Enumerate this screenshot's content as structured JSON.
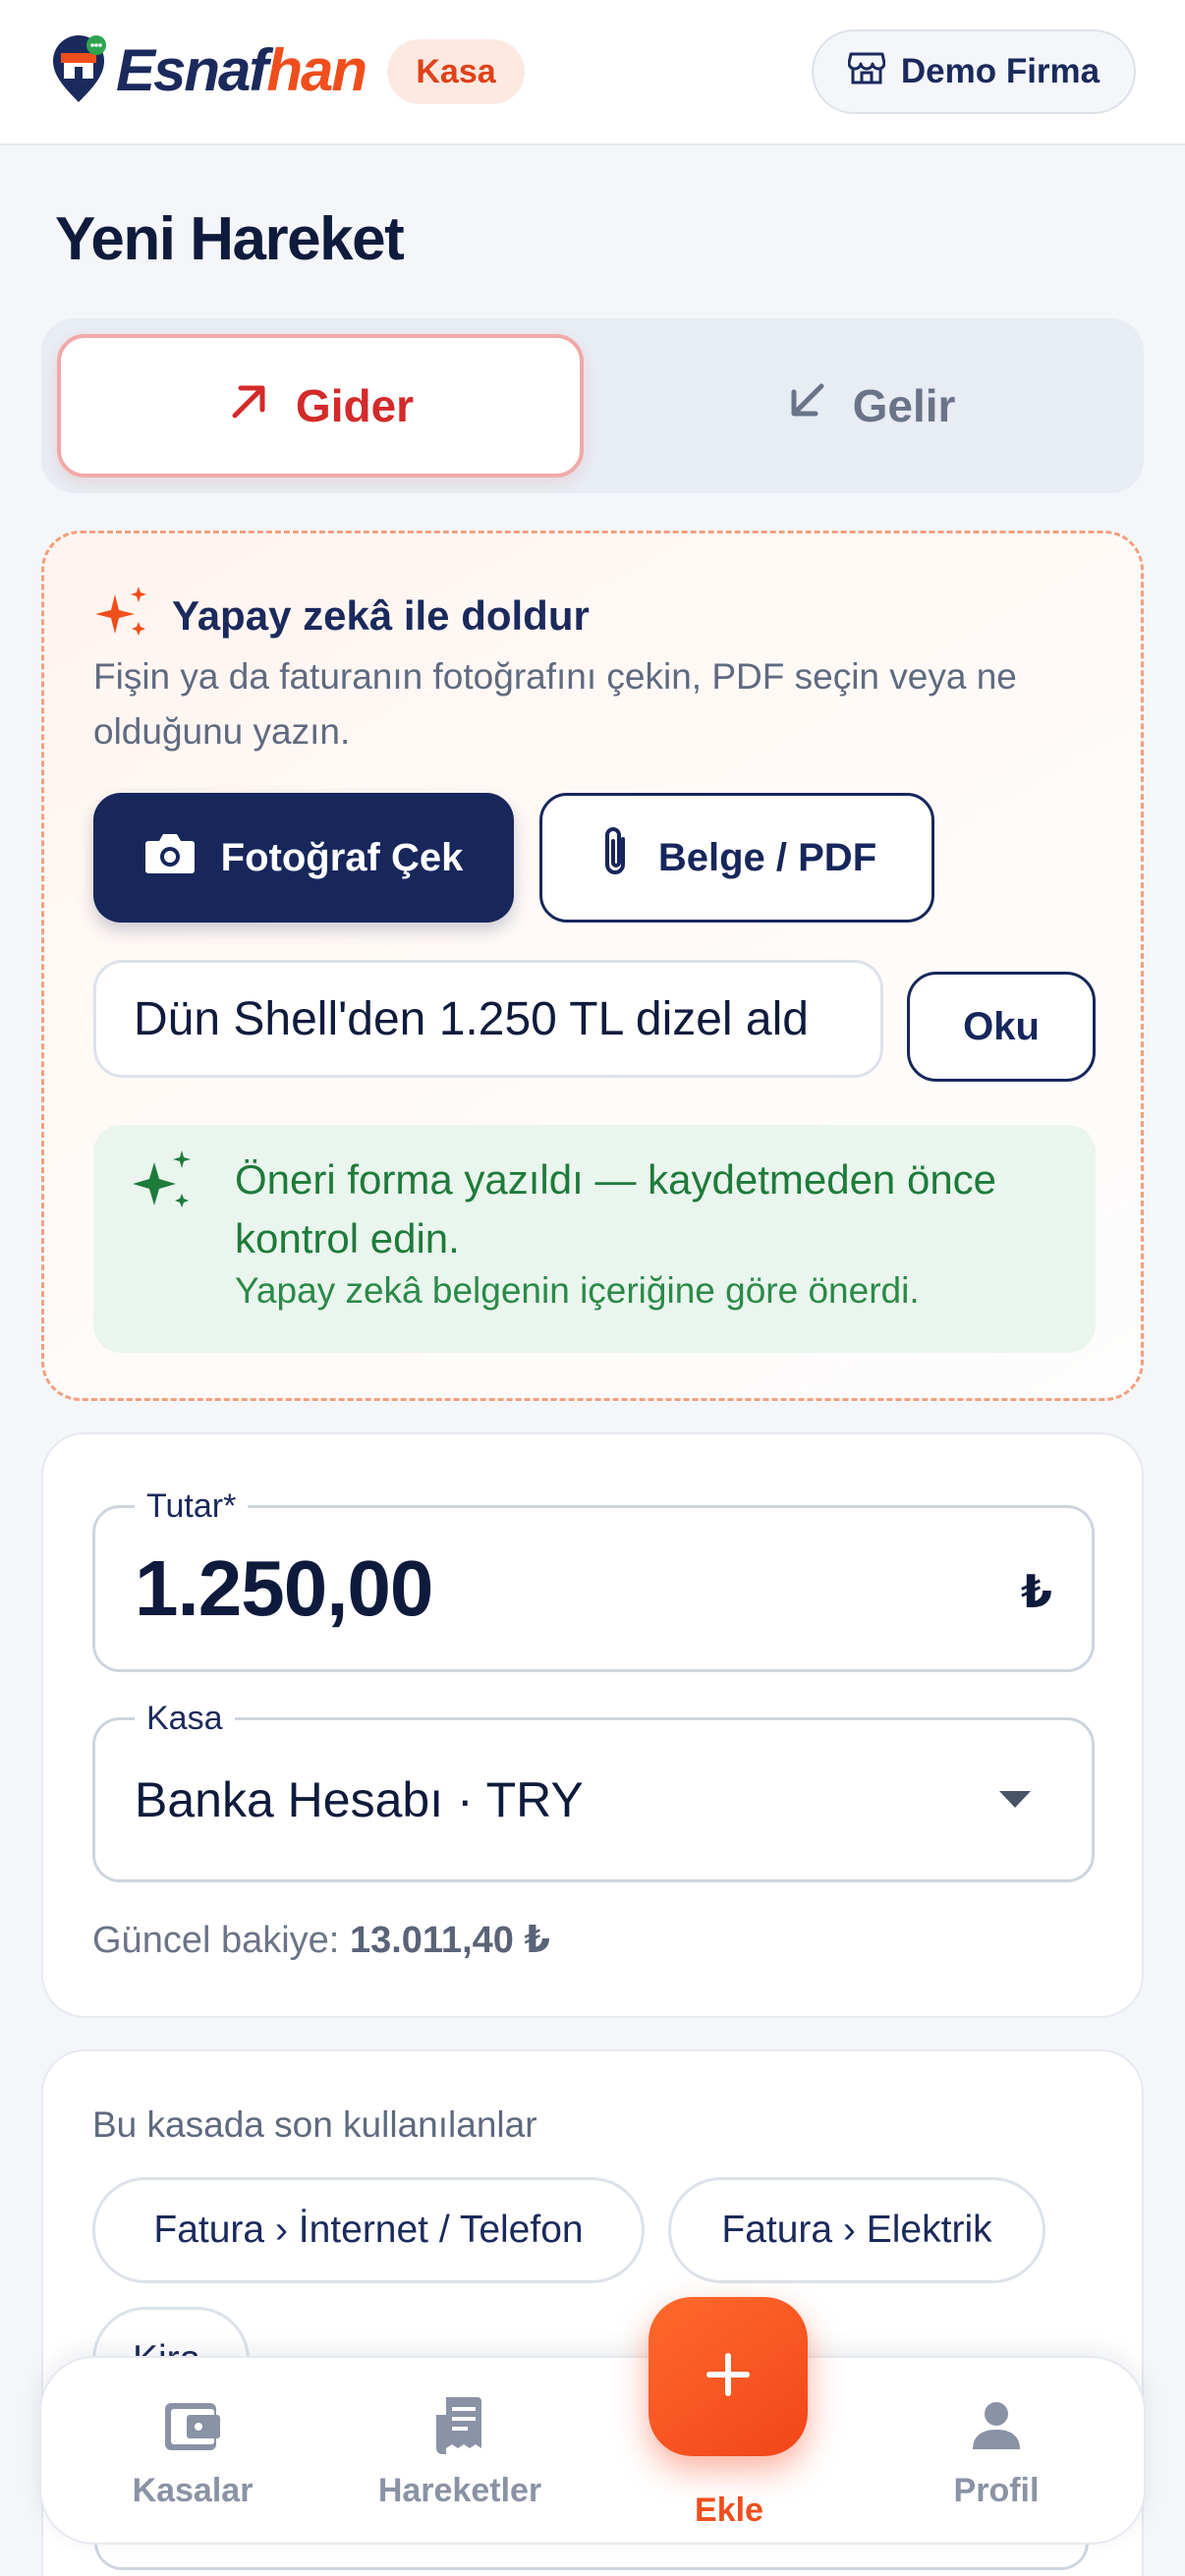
{
  "header": {
    "logo_text_part1": "Esnaf",
    "logo_text_part2": "han",
    "module_label": "Kasa",
    "firm_label": "Demo Firma",
    "icons": [
      "store-logo-icon",
      "storefront-icon"
    ]
  },
  "page": {
    "title": "Yeni Hareket"
  },
  "type_toggle": {
    "gider_label": "Gider",
    "gelir_label": "Gelir",
    "selected": "Gider"
  },
  "ai_fill": {
    "title": "Yapay zekâ ile doldur",
    "description": "Fişin ya da faturanın fotoğrafını çekin, PDF seçin veya ne olduğunu yazın.",
    "photo_button": "Fotoğraf Çek",
    "pdf_button": "Belge / PDF",
    "input_value": "Dün Shell'den 1.250 TL dizel ald",
    "read_button": "Oku",
    "success_title": "Öneri forma yazıldı — kaydetmeden önce kontrol edin.",
    "success_sub": "Yapay zekâ belgenin içeriğine göre önerdi."
  },
  "form": {
    "amount_label": "Tutar*",
    "amount_value": "1.250,00",
    "currency_symbol": "₺",
    "kasa_label": "Kasa",
    "kasa_value": "Banka Hesabı · TRY",
    "balance_label": "Güncel bakiye:",
    "balance_value": "13.011,40 ₺"
  },
  "recent": {
    "title": "Bu kasada son kullanılanlar",
    "chips": [
      "Fatura › İnternet / Telefon",
      "Fatura › Elektrik",
      "Kira"
    ]
  },
  "bottom_nav": {
    "items": [
      {
        "label": "Kasalar",
        "icon": "wallet-icon"
      },
      {
        "label": "Hareketler",
        "icon": "receipt-icon"
      },
      {
        "label": "Ekle",
        "icon": "plus-icon"
      },
      {
        "label": "Profil",
        "icon": "person-icon"
      }
    ]
  },
  "colors": {
    "accent": "#f04e1c",
    "navy": "#17275c",
    "expense_red": "#d42a2a",
    "success_green": "#1e7b3a"
  }
}
